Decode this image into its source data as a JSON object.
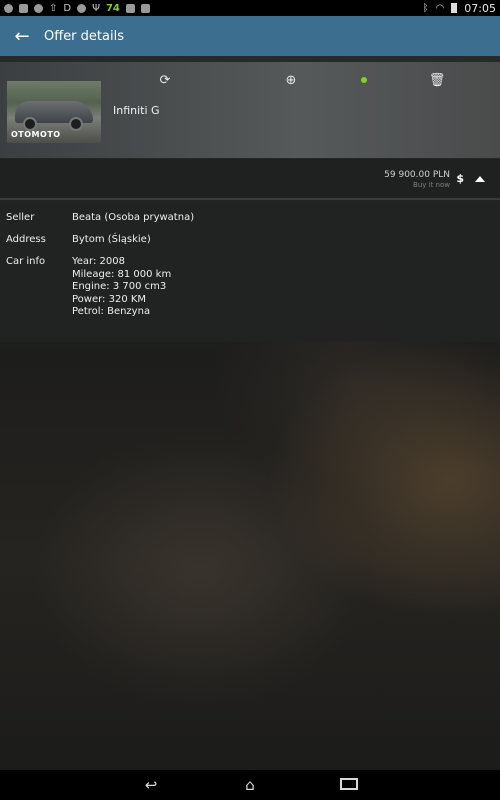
{
  "status_bar": {
    "left_icons": [
      "chat-icon",
      "image-icon",
      "pinterest-icon",
      "upload-icon",
      "d-icon",
      "browser-icon",
      "usb-icon",
      "battery-percent-icon",
      "shop-icon",
      "notes-icon"
    ],
    "battery_percent": "74",
    "d_letter": "D",
    "time": "07:05"
  },
  "app_bar": {
    "back_icon": "←",
    "title": "Offer details"
  },
  "offer": {
    "image_watermark": "OTOMOTO",
    "title": "Infiniti G",
    "actions": {
      "refresh_icon": "⟳",
      "web_icon": "⊕",
      "status_color": "#7ed321",
      "delete_icon": "🗑"
    }
  },
  "price": {
    "amount": "59 900.00 PLN",
    "type": "Buy it now",
    "currency_button": "$",
    "collapse_icon": "chevron-up-icon"
  },
  "details": {
    "seller_label": "Seller",
    "seller_value": "Beata (Osoba prywatna)",
    "address_label": "Address",
    "address_value": "Bytom (Śląskie)",
    "carinfo_label": "Car info",
    "carinfo_lines": [
      "Year: 2008",
      "Mileage: 81 000 km",
      "Engine: 3 700 cm3",
      "Power: 320 KM",
      "Petrol: Benzyna"
    ]
  },
  "nav_bar": {
    "back_icon": "↩",
    "home_icon": "⌂"
  }
}
